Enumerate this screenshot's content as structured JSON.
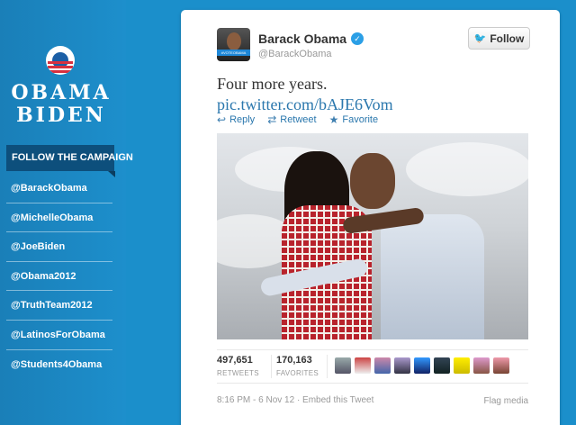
{
  "sidebar": {
    "brand_line1": "OBAMA",
    "brand_line2": "BIDEN",
    "follow_banner": "FOLLOW THE CAMPAIGN",
    "handles": [
      "@BarackObama",
      "@MichelleObama",
      "@JoeBiden",
      "@Obama2012",
      "@TruthTeam2012",
      "@LatinosForObama",
      "@Students4Obama"
    ]
  },
  "tweet": {
    "display_name": "Barack Obama",
    "screen_name": "@BarackObama",
    "follow_label": "Follow",
    "avatar_badge": "#VOTEOBAMA",
    "text": "Four more years.",
    "link": "pic.twitter.com/bAJE6Vom",
    "actions": {
      "reply": "Reply",
      "retweet": "Retweet",
      "favorite": "Favorite"
    },
    "stats": {
      "retweets_count": "497,651",
      "retweets_label": "RETWEETS",
      "favorites_count": "170,163",
      "favorites_label": "FAVORITES"
    },
    "timestamp": "8:16 PM - 6 Nov 12",
    "embed_label": "Embed this Tweet",
    "flag_label": "Flag media"
  },
  "icons": {
    "reply": "reply-arrow-icon",
    "retweet": "retweet-icon",
    "favorite": "star-icon",
    "verified": "verified-check-icon",
    "follow": "twitter-bird-icon"
  },
  "colors": {
    "background": "#1b8fcb",
    "banner": "#0d4f7c",
    "link": "#2a77ad",
    "verified": "#2b9fe6"
  }
}
